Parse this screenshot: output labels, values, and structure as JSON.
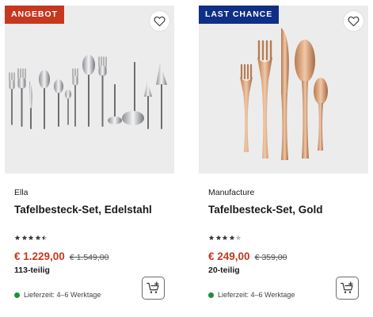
{
  "products": [
    {
      "badge": "ANGEBOT",
      "badge_color": "#c6371f",
      "brand": "Ella",
      "title": "Tafelbesteck-Set, Edelstahl",
      "rating": 4.5,
      "rating_max": 5,
      "price": "€ 1.229,00",
      "old_price": "€ 1.549,00",
      "pieces": "113-teilig",
      "delivery": "Lieferzeit: 4–6 Werktage",
      "image_icon": "stainless-cutlery-set-image"
    },
    {
      "badge": "LAST CHANCE",
      "badge_color": "#0f2e86",
      "brand": "Manufacture",
      "title": "Tafelbesteck-Set, Gold",
      "rating": 4,
      "rating_max": 5,
      "price": "€ 249,00",
      "old_price": "€ 359,00",
      "pieces": "20-teilig",
      "delivery": "Lieferzeit: 4–6 Werktage",
      "image_icon": "gold-cutlery-set-image"
    }
  ],
  "colors": {
    "sale_red": "#c6371f",
    "chance_blue": "#0f2e86",
    "delivery_green": "#1e8e3e",
    "image_bg": "#ececec"
  }
}
